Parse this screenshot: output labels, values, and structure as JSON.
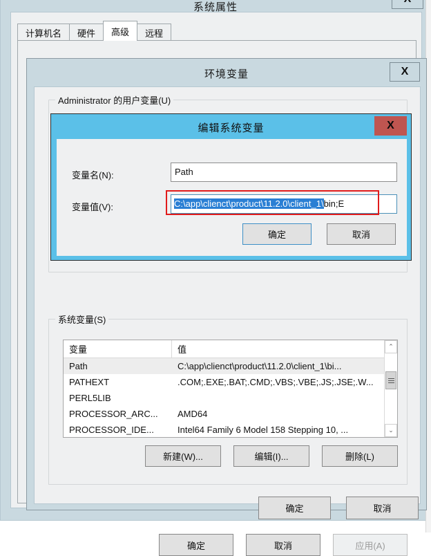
{
  "system_properties": {
    "title": "系统属性",
    "close_label": "X",
    "tabs": [
      {
        "label": "计算机名",
        "active": false
      },
      {
        "label": "硬件",
        "active": false
      },
      {
        "label": "高级",
        "active": true
      },
      {
        "label": "远程",
        "active": false
      }
    ],
    "footer": {
      "ok_label": "确定",
      "cancel_label": "取消",
      "apply_label": "应用(A)"
    }
  },
  "environment_variables": {
    "title": "环境变量",
    "close_label": "X",
    "user_variables": {
      "legend": "Administrator 的用户变量(U)"
    },
    "system_variables": {
      "legend": "系统变量(S)",
      "columns": [
        "变量",
        "值"
      ],
      "rows": [
        {
          "name": "Path",
          "value": "C:\\app\\clienct\\product\\11.2.0\\client_1\\bi...",
          "selected": true
        },
        {
          "name": "PATHEXT",
          "value": ".COM;.EXE;.BAT;.CMD;.VBS;.VBE;.JS;.JSE;.W...",
          "selected": false
        },
        {
          "name": "PERL5LIB",
          "value": "",
          "selected": false
        },
        {
          "name": "PROCESSOR_ARC...",
          "value": "AMD64",
          "selected": false
        },
        {
          "name": "PROCESSOR_IDE...",
          "value": "Intel64 Family 6 Model 158 Stepping 10, ...",
          "selected": false
        }
      ],
      "buttons": {
        "new_label": "新建(W)...",
        "edit_label": "编辑(I)...",
        "delete_label": "删除(L)"
      },
      "scrollbar": {
        "up_arrow": "⌃",
        "down_arrow": "⌄"
      }
    },
    "footer": {
      "ok_label": "确定",
      "cancel_label": "取消"
    }
  },
  "edit_system_variable": {
    "title": "编辑系统变量",
    "close_label": "X",
    "name_label": "变量名(N):",
    "name_value": "Path",
    "value_label": "变量值(V):",
    "value_selected_text": "C:\\app\\clienct\\product\\11.2.0\\client_1\\",
    "value_trailing_text": "bin;E",
    "footer": {
      "ok_label": "确定",
      "cancel_label": "取消"
    }
  },
  "colors": {
    "window_chrome": "#c9d9e0",
    "dialog_face": "#eff0f1",
    "edit_dialog_titlebar": "#5bc0e8",
    "close_button_red": "#bf5550",
    "selection_blue": "#2a7fd4",
    "highlight_red": "#e11b1b",
    "row_selected": "#ededed",
    "focus_blue": "#3d8fc6"
  }
}
